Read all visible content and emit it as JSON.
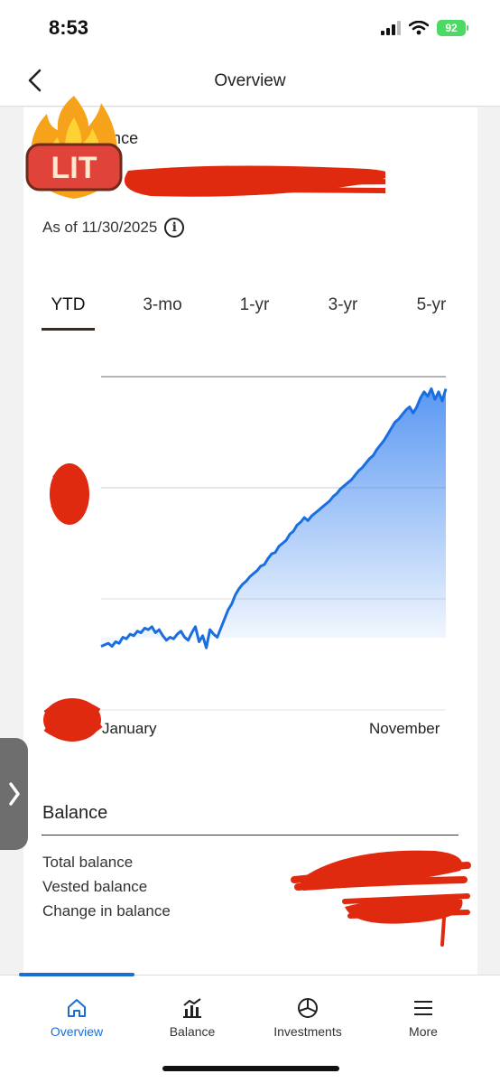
{
  "status_bar": {
    "time": "8:53",
    "battery": "92"
  },
  "nav": {
    "title": "Overview"
  },
  "balance_card": {
    "label": "Total balance",
    "as_of": "As of 11/30/2025",
    "info_glyph": "i"
  },
  "range_tabs": [
    {
      "label": "YTD",
      "active": true
    },
    {
      "label": "3-mo"
    },
    {
      "label": "1-yr"
    },
    {
      "label": "3-yr"
    },
    {
      "label": "5-yr"
    }
  ],
  "chart_data": {
    "type": "area",
    "x_tick_labels": [
      "January",
      "November"
    ],
    "series_color": "#1a6fe0",
    "grid": true,
    "values": [
      42,
      43,
      44,
      42,
      45,
      44,
      48,
      47,
      50,
      49,
      52,
      51,
      54,
      53,
      55,
      51,
      53,
      49,
      46,
      48,
      47,
      50,
      52,
      48,
      46,
      51,
      55,
      45,
      49,
      41,
      53,
      50,
      48,
      54,
      60,
      66,
      70,
      76,
      80,
      83,
      85,
      88,
      90,
      92,
      95,
      96,
      100,
      103,
      104,
      108,
      110,
      112,
      116,
      118,
      122,
      124,
      127,
      125,
      128,
      130,
      132,
      134,
      136,
      138,
      141,
      143,
      146,
      148,
      150,
      152,
      155,
      158,
      160,
      163,
      166,
      168,
      172,
      175,
      178,
      182,
      186,
      190,
      192,
      195,
      198,
      200,
      196,
      200,
      206,
      210,
      207,
      212,
      205,
      210,
      204,
      212
    ],
    "ylim": [
      0,
      220
    ]
  },
  "balance_section": {
    "title": "Balance",
    "rows": [
      "Total balance",
      "Vested balance",
      "Change in balance"
    ]
  },
  "sticker": {
    "text": "LIT"
  },
  "bottom_nav": [
    {
      "label": "Overview",
      "icon": "home-icon",
      "active": true
    },
    {
      "label": "Balance",
      "icon": "bar-chart-icon"
    },
    {
      "label": "Investments",
      "icon": "pie-chart-icon"
    },
    {
      "label": "More",
      "icon": "menu-icon"
    }
  ],
  "colors": {
    "accent": "#1a6fd6",
    "redaction": "#e02a10",
    "tab_underline": "#3a2a20"
  }
}
